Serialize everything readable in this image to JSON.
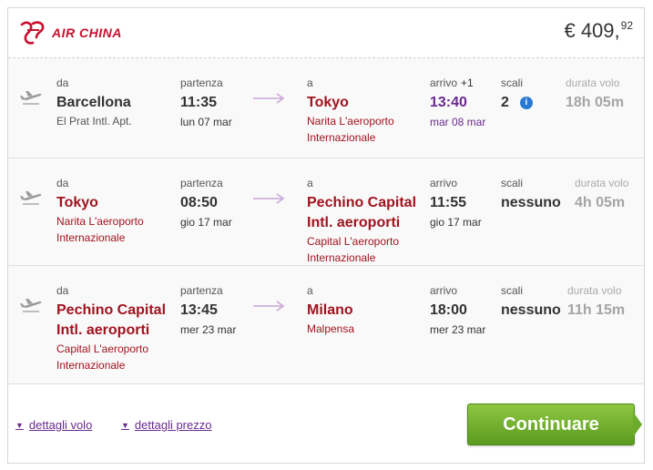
{
  "airline": {
    "name": "AIR CHINA",
    "brand_color": "#c8102e",
    "logo_icon": "air-china-phoenix-logo"
  },
  "price": {
    "currency": "€",
    "whole": "409,",
    "cents": "92"
  },
  "labels": {
    "from": "da",
    "departure": "partenza",
    "to": "a",
    "arrival": "arrivo",
    "stops": "scali",
    "duration": "durata volo"
  },
  "legs": [
    {
      "from_city": "Barcellona",
      "from_airport": [
        "El Prat Intl. Apt."
      ],
      "dep_time": "11:35",
      "dep_date": "lun 07 mar",
      "to_city": "Tokyo",
      "to_airport": [
        "Narita L'aeroporto",
        "Internazionale"
      ],
      "arr_time": "13:40",
      "arr_date": "mar 08 mar",
      "arr_offset": "+1",
      "stops": "2",
      "duration": "18h 05m"
    },
    {
      "from_city": "Tokyo",
      "from_airport": [
        "Narita L'aeroporto",
        "Internazionale"
      ],
      "dep_time": "08:50",
      "dep_date": "gio 17 mar",
      "to_city": [
        "Pechino Capital",
        "Intl. aeroporti"
      ],
      "to_airport": [
        "Capital L'aeroporto",
        "Internazionale"
      ],
      "arr_time": "11:55",
      "arr_date": "gio 17 mar",
      "stops": "nessuno",
      "duration": "4h 05m"
    },
    {
      "from_city": [
        "Pechino Capital",
        "Intl. aeroporti"
      ],
      "from_airport": [
        "Capital L'aeroporto",
        "Internazionale"
      ],
      "dep_time": "13:45",
      "dep_date": "mer 23 mar",
      "to_city": "Milano",
      "to_airport": [
        "Malpensa"
      ],
      "arr_time": "18:00",
      "arr_date": "mer 23 mar",
      "stops": "nessuno",
      "duration": "11h 15m"
    }
  ],
  "footer": {
    "flight_details": "dettagli volo",
    "price_details": "dettagli prezzo",
    "continue": "Continuare"
  },
  "colors": {
    "button": "#6cab2b",
    "link": "#6a2a8e",
    "city_red": "#a0131f",
    "info": "#2a7ad2"
  }
}
